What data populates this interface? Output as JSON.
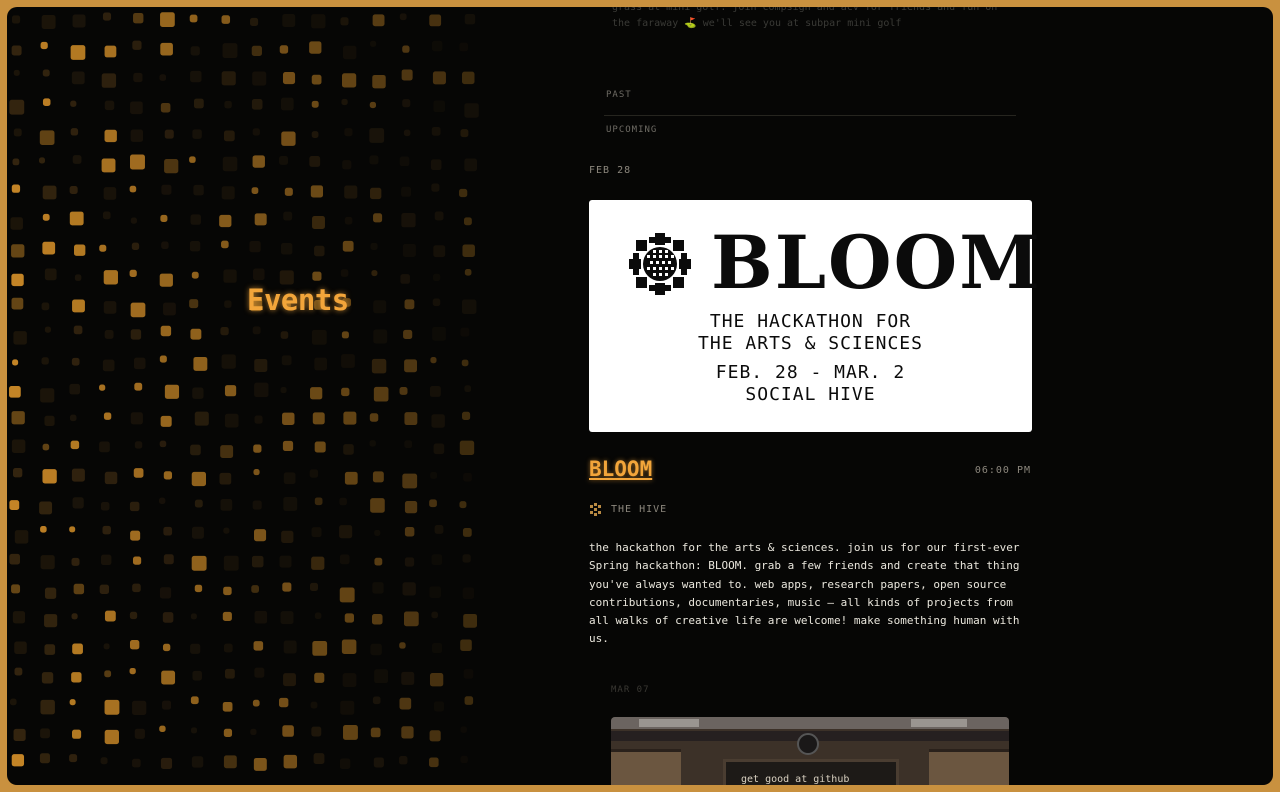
{
  "page": {
    "title": "Events"
  },
  "previous_event": {
    "description": "grass at mini golf. join compsign and acv for friends and fun on the faraway ⛳ we'll see you at subpar mini golf"
  },
  "tabs": {
    "past": "PAST",
    "upcoming": "UPCOMING"
  },
  "event": {
    "date": "FEB 28",
    "banner": {
      "title": "BLOOM",
      "line1": "THE HACKATHON FOR",
      "line2": "THE ARTS & SCIENCES",
      "line3": "FEB. 28 - MAR. 2",
      "line4": "SOCIAL HIVE",
      "icon": "sunflower-icon"
    },
    "name": "BLOOM",
    "time": "06:00 PM",
    "venue": "THE HIVE",
    "venue_icon": "hive-icon",
    "description": "the hackathon for the arts & sciences. join us for our first-ever Spring hackathon: BLOOM. grab a few friends and create that thing you've always wanted to. web apps, research papers, open source contributions, documentaries, music — all kinds of projects from all walks of creative life are welcome! make something human with us."
  },
  "next_event": {
    "date": "MAR 07",
    "board_text": "get good at github"
  },
  "colors": {
    "accent": "#f2a53a",
    "frame": "#c9913f",
    "background": "#060605"
  }
}
